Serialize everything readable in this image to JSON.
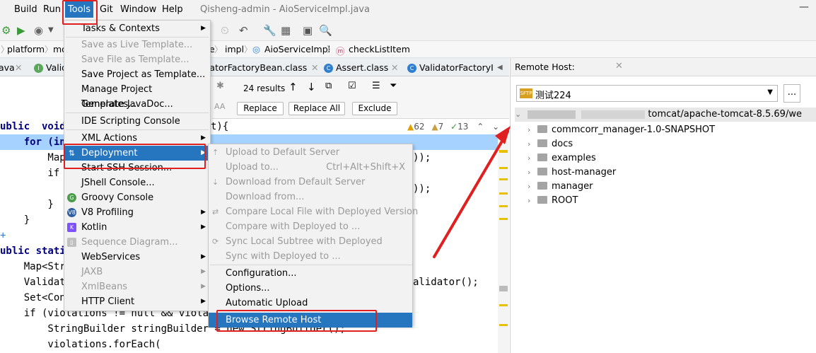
{
  "menubar": {
    "items": [
      "Build",
      "Run",
      "Tools",
      "Git",
      "Window",
      "Help"
    ],
    "window_title": "Qisheng-admin - AioServiceImpl.java"
  },
  "breadcrumb": [
    "platform",
    "mo",
    "e",
    "impl",
    "AioServiceImpl",
    "checkListItem"
  ],
  "tabs": [
    "ava",
    "Valid",
    "idatorFactoryBean.class",
    "Assert.class",
    "ValidatorFactoryI"
  ],
  "find": {
    "results": "24 results",
    "replace": "Replace",
    "replace_all": "Replace All",
    "exclude": "Exclude"
  },
  "inspections": {
    "warnings": "62",
    "weak": "7",
    "ok": "13"
  },
  "code": {
    "lines": [
      "ublic  void",
      "    for (in",
      "        Map",
      "        if",
      "",
      "        }",
      "    }",
      "",
      "ublic stati",
      "    Map<Stri",
      "    Validato",
      "    Set<Cons",
      "    if (violations != null && violatio",
      "        StringBuilder stringBuilder = new StringBuilder();",
      "        violations.forEach("
    ],
    "right_fragments": [
      "t){",
      "));",
      "));",
      "alidator();"
    ]
  },
  "tools_menu": {
    "items": [
      {
        "label": "Tasks & Contexts",
        "disabled": false,
        "submenu": true
      },
      {
        "label": "Save as Live Template...",
        "disabled": true
      },
      {
        "label": "Save File as Template...",
        "disabled": true
      },
      {
        "label": "Save Project as Template...",
        "disabled": false
      },
      {
        "label": "Manage Project Templates...",
        "disabled": false
      },
      {
        "label": "Generate JavaDoc...",
        "disabled": false
      },
      {
        "label": "IDE Scripting Console",
        "disabled": false
      },
      {
        "label": "XML Actions",
        "disabled": false,
        "submenu": true
      },
      {
        "label": "Deployment",
        "disabled": false,
        "submenu": true,
        "selected": true
      },
      {
        "label": "Start SSH Session...",
        "disabled": false
      },
      {
        "label": "JShell Console...",
        "disabled": false
      },
      {
        "label": "Groovy Console",
        "disabled": false
      },
      {
        "label": "V8 Profiling",
        "disabled": false,
        "submenu": true
      },
      {
        "label": "Kotlin",
        "disabled": false,
        "submenu": true
      },
      {
        "label": "Sequence Diagram...",
        "disabled": true
      },
      {
        "label": "WebServices",
        "disabled": false,
        "submenu": true
      },
      {
        "label": "JAXB",
        "disabled": true,
        "submenu": true
      },
      {
        "label": "XmlBeans",
        "disabled": true,
        "submenu": true
      },
      {
        "label": "HTTP Client",
        "disabled": false,
        "submenu": true
      }
    ]
  },
  "deployment_menu": {
    "items": [
      {
        "label": "Upload to Default Server",
        "disabled": true,
        "shortcut": ""
      },
      {
        "label": "Upload to...",
        "disabled": true,
        "shortcut": "Ctrl+Alt+Shift+X"
      },
      {
        "label": "Download from Default Server",
        "disabled": true,
        "shortcut": ""
      },
      {
        "label": "Download from...",
        "disabled": true,
        "shortcut": ""
      },
      {
        "label": "Compare Local File with Deployed Version",
        "disabled": true,
        "shortcut": ""
      },
      {
        "label": "Compare with Deployed to ...",
        "disabled": true,
        "shortcut": ""
      },
      {
        "label": "Sync Local Subtree with Deployed",
        "disabled": true,
        "shortcut": ""
      },
      {
        "label": "Sync with Deployed to ...",
        "disabled": true,
        "shortcut": ""
      },
      {
        "label": "Configuration...",
        "disabled": false,
        "shortcut": ""
      },
      {
        "label": "Options...",
        "disabled": false,
        "shortcut": ""
      },
      {
        "label": "Automatic Upload",
        "disabled": false,
        "shortcut": ""
      },
      {
        "label": "Browse Remote Host",
        "disabled": false,
        "shortcut": "",
        "selected": true
      }
    ]
  },
  "remote_host": {
    "title": "Remote Host:",
    "server": "测试224",
    "path_tail": "tomcat/apache-tomcat-8.5.69/we",
    "folders": [
      "commcorr_manager-1.0-SNAPSHOT",
      "docs",
      "examples",
      "host-manager",
      "manager",
      "ROOT"
    ]
  },
  "colors": {
    "selection": "#2675bf",
    "highlight_box": "#e02020",
    "arrow": "#e02020"
  }
}
